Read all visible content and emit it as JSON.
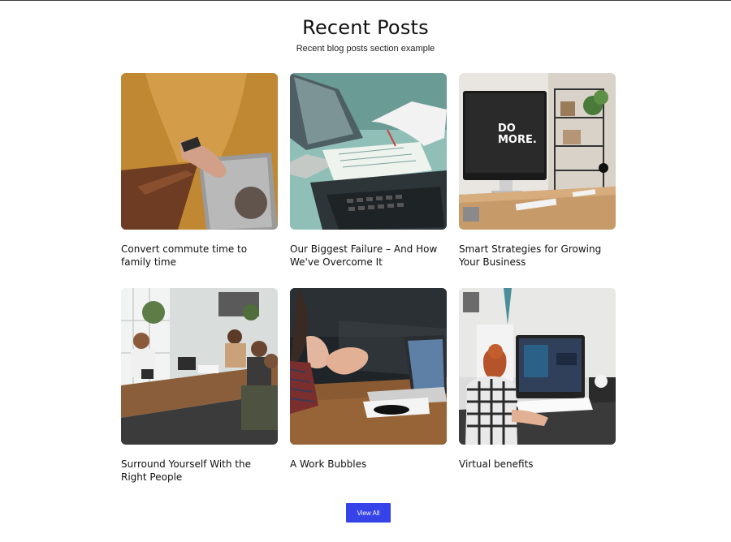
{
  "section": {
    "title": "Recent Posts",
    "subtitle": "Recent blog posts section example"
  },
  "posts": [
    {
      "title": "Convert commute time to family time",
      "image": "laptop-yellow-sweater-photo"
    },
    {
      "title": "Our Biggest Failure – And How We've Overcome It",
      "image": "laptops-paperwork-photo"
    },
    {
      "title": "Smart Strategies for Growing Your Business",
      "image": "desk-monitor-do-more-photo",
      "monitor_text": "DO MORE."
    },
    {
      "title": "Surround Yourself With the Right People",
      "image": "team-meeting-photo"
    },
    {
      "title": "A Work Bubbles",
      "image": "hands-laptop-photo"
    },
    {
      "title": "Virtual benefits",
      "image": "woman-computer-photo"
    }
  ],
  "actions": {
    "view_all_label": "View All"
  },
  "colors": {
    "button": "#3543e8",
    "text": "#111111"
  }
}
